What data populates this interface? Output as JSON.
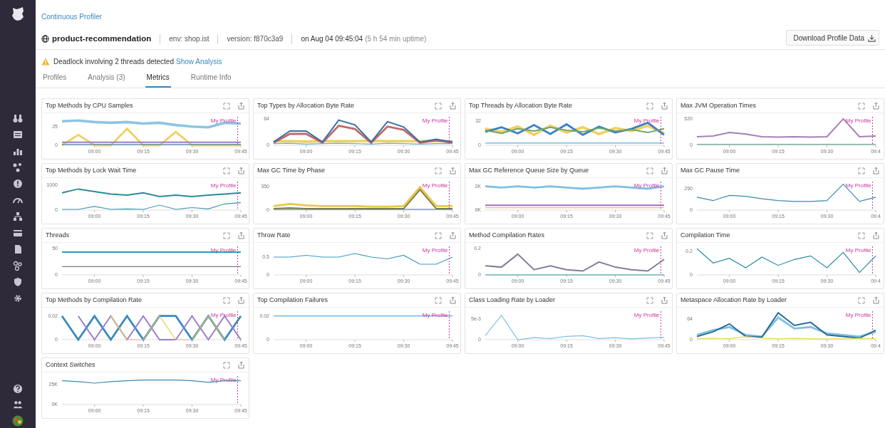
{
  "breadcrumb": "Continuous Profiler",
  "service": {
    "name": "product-recommendation",
    "env": "env: shop.ist",
    "version": "version: f870c3a9",
    "timestamp": "on Aug 04 09:45:04",
    "uptime": "(5 h 54 min uptime)"
  },
  "download_button": "Download Profile Data",
  "alert": {
    "message": "Deadlock involving 2 threads detected",
    "link": "Show Analysis"
  },
  "tabs": [
    {
      "label": "Profiles",
      "selected": false
    },
    {
      "label": "Analysis (3)",
      "selected": false
    },
    {
      "label": "Metrics",
      "selected": true
    },
    {
      "label": "Runtime Info",
      "selected": false
    }
  ],
  "panels": [
    {
      "title": "Top Methods by CPU Samples",
      "chart_data": {
        "type": "line",
        "categories": [
          null,
          null,
          "09:00",
          null,
          null,
          "09:15",
          null,
          null,
          "09:30",
          null,
          null,
          "09:45"
        ],
        "ylim": [
          0,
          38
        ],
        "yticks": [
          0,
          25
        ],
        "annotations": [
          "My Profile"
        ],
        "series": [
          {
            "color": "#8ec5e0",
            "values": [
              32,
              33,
              31,
              30,
              31,
              29,
              30,
              27,
              25,
              24,
              30,
              29
            ]
          },
          {
            "color": "#f0d060",
            "values": [
              0,
              14,
              0,
              0,
              22,
              0,
              0,
              18,
              0,
              0,
              0,
              0
            ]
          },
          {
            "color": "#9b7ec8",
            "values": [
              4,
              4,
              4,
              4,
              4,
              4,
              4,
              4,
              4,
              4,
              4,
              4
            ]
          },
          {
            "color": "#4a7fa8",
            "values": [
              1,
              1,
              1,
              1,
              1,
              1,
              1,
              1,
              1,
              1,
              1,
              1
            ]
          }
        ]
      }
    },
    {
      "title": "Top Types by Allocation Byte Rate",
      "chart_data": {
        "type": "line",
        "categories": [
          null,
          null,
          "09:00",
          null,
          null,
          "09:15",
          null,
          null,
          "09:30",
          null,
          null,
          "09:45"
        ],
        "ylim": [
          0,
          70
        ],
        "yticks": [
          0,
          64
        ],
        "annotations": [
          "My Profile"
        ],
        "series": [
          {
            "color": "#f0d060",
            "values": [
              10,
              10,
              9,
              10,
              10,
              10,
              11,
              10,
              10,
              10,
              10,
              10
            ]
          },
          {
            "color": "#c06a6a",
            "values": [
              6,
              28,
              28,
              6,
              48,
              40,
              6,
              46,
              38,
              6,
              12,
              6
            ]
          },
          {
            "color": "#3a6ea5",
            "values": [
              8,
              35,
              35,
              8,
              62,
              50,
              8,
              58,
              45,
              8,
              15,
              8
            ]
          },
          {
            "color": "#5ab0d8",
            "values": [
              4,
              5,
              3,
              4,
              5,
              4,
              3,
              5,
              4,
              3,
              4,
              4
            ]
          }
        ]
      }
    },
    {
      "title": "Top Threads by Allocation Byte Rate",
      "chart_data": {
        "type": "line",
        "categories": [
          null,
          null,
          "09:00",
          null,
          null,
          "09:15",
          null,
          null,
          "09:30",
          null,
          null,
          "09:45"
        ],
        "ylim": [
          0,
          38
        ],
        "yticks": [
          0,
          32
        ],
        "annotations": [
          "My Profile"
        ],
        "series": [
          {
            "color": "#f0d060",
            "values": [
              22,
              18,
              25,
              14,
              26,
              17,
              24,
              15,
              23,
              19,
              26,
              16
            ]
          },
          {
            "color": "#3a7fc8",
            "values": [
              18,
              24,
              16,
              27,
              15,
              28,
              14,
              25,
              17,
              22,
              30,
              14
            ]
          },
          {
            "color": "#6aa86a",
            "values": [
              20,
              16,
              22,
              19,
              24,
              20,
              18,
              23,
              19,
              21,
              17,
              22
            ]
          },
          {
            "color": "#5ab0d8",
            "values": [
              3,
              3,
              3,
              3,
              3,
              3,
              3,
              3,
              3,
              3,
              3,
              3
            ]
          }
        ]
      }
    },
    {
      "title": "Max JVM Operation Times",
      "chart_data": {
        "type": "line",
        "categories": [
          null,
          null,
          "09:00",
          null,
          null,
          "09:15",
          null,
          null,
          "09:30",
          null,
          null,
          "09:4"
        ],
        "ylim": [
          0,
          560
        ],
        "yticks": [
          0,
          520
        ],
        "annotations": [
          "My Profile"
        ],
        "series": [
          {
            "color": "#a47fb8",
            "values": [
              170,
              180,
              250,
              220,
              170,
              160,
              170,
              160,
              170,
              520,
              170,
              180
            ]
          },
          {
            "color": "#6aa88a",
            "values": [
              20,
              20,
              20,
              20,
              20,
              20,
              20,
              20,
              20,
              20,
              20,
              20
            ]
          }
        ]
      }
    },
    {
      "title": "Top Methods by Lock Wait Time",
      "chart_data": {
        "type": "line",
        "categories": [
          null,
          null,
          "09:00",
          null,
          null,
          "09:15",
          null,
          null,
          "09:30",
          null,
          null,
          "09:45"
        ],
        "ylim": [
          0,
          1150
        ],
        "yticks": [
          0,
          1000
        ],
        "annotations": [
          "My Profile"
        ],
        "series": [
          {
            "color": "#2a8a9a",
            "values": [
              700,
              850,
              750,
              650,
              600,
              700,
              550,
              600,
              550,
              600,
              650,
              700
            ]
          },
          {
            "color": "#3a9aa8",
            "values": [
              30,
              30,
              150,
              30,
              50,
              30,
              200,
              30,
              100,
              50,
              250,
              300
            ]
          }
        ]
      }
    },
    {
      "title": "Max GC Time by Phase",
      "chart_data": {
        "type": "line",
        "categories": [
          null,
          null,
          "09:00",
          null,
          null,
          "09:15",
          null,
          null,
          "09:30",
          null,
          null,
          "09:45"
        ],
        "ylim": [
          0,
          420
        ],
        "yticks": [
          0,
          350
        ],
        "annotations": [
          "My Profile"
        ],
        "series": [
          {
            "color": "#e8c84a",
            "values": [
              60,
              90,
              70,
              60,
              60,
              60,
              50,
              50,
              60,
              340,
              60,
              60
            ]
          },
          {
            "color": "#8a7a40",
            "values": [
              20,
              30,
              20,
              20,
              20,
              20,
              20,
              20,
              20,
              300,
              20,
              20
            ]
          },
          {
            "color": "#4a6ab8",
            "values": [
              10,
              10,
              10,
              10,
              10,
              10,
              10,
              10,
              10,
              10,
              10,
              10
            ]
          }
        ]
      }
    },
    {
      "title": "Max GC Reference Queue Size by Queue",
      "chart_data": {
        "type": "line",
        "categories": [
          null,
          null,
          "09:00",
          null,
          null,
          "09:15",
          null,
          null,
          "09:30",
          null,
          null,
          "09:45"
        ],
        "ylim": [
          0,
          2400
        ],
        "yticks": [
          {
            "value": 0,
            "label": "0K"
          },
          {
            "value": 2000,
            "label": "2K"
          }
        ],
        "annotations": [
          "My Profile"
        ],
        "series": [
          {
            "color": "#7ec0e0",
            "values": [
              2000,
              1900,
              2000,
              1900,
              2000,
              1900,
              1800,
              1900,
              2000,
              1900,
              1800,
              2000
            ]
          },
          {
            "color": "#9b6ec8",
            "values": [
              400,
              400,
              400,
              400,
              400,
              400,
              400,
              400,
              400,
              400,
              400,
              400
            ]
          },
          {
            "color": "#e8c84a",
            "values": [
              200,
              200,
              200,
              200,
              200,
              200,
              200,
              200,
              200,
              200,
              200,
              200
            ]
          }
        ]
      }
    },
    {
      "title": "Max GC Pause Time",
      "chart_data": {
        "type": "line",
        "categories": [
          null,
          null,
          "09:00",
          null,
          null,
          "09:15",
          null,
          null,
          "09:30",
          null,
          null,
          "09:4"
        ],
        "ylim": [
          0,
          330
        ],
        "yticks": [
          0,
          250
        ],
        "annotations": [
          "My Profile"
        ],
        "series": [
          {
            "color": "#3a8ab0",
            "values": [
              150,
              110,
              170,
              160,
              130,
              110,
              100,
              100,
              110,
              300,
              100,
              150
            ]
          }
        ]
      }
    },
    {
      "title": "Threads",
      "chart_data": {
        "type": "line",
        "categories": [
          null,
          null,
          "09:00",
          null,
          null,
          "09:15",
          null,
          null,
          "09:30",
          null,
          null,
          "09:45"
        ],
        "ylim": [
          0,
          55
        ],
        "yticks": [
          0,
          50
        ],
        "annotations": [
          "My Profile"
        ],
        "series": [
          {
            "color": "#2a9ac0",
            "values": [
              44,
              44,
              44,
              44,
              44,
              44,
              44,
              44,
              44,
              44,
              44,
              44
            ]
          },
          {
            "color": "#7a7a8a",
            "values": [
              16,
              16,
              16,
              16,
              16,
              16,
              16,
              16,
              16,
              16,
              16,
              16
            ]
          }
        ]
      }
    },
    {
      "title": "Throw Rate",
      "chart_data": {
        "type": "line",
        "categories": [
          null,
          null,
          "09:00",
          null,
          null,
          "09:15",
          null,
          null,
          "09:30",
          null,
          null,
          "09:45"
        ],
        "ylim": [
          0,
          0.8
        ],
        "yticks": [
          0,
          0.5
        ],
        "annotations": [
          "My Profile"
        ],
        "series": [
          {
            "color": "#3a9ac0",
            "values": [
              0.5,
              0.5,
              0.55,
              0.5,
              0.5,
              0.6,
              0.5,
              0.45,
              0.55,
              0.3,
              0.3,
              0.5
            ]
          }
        ]
      }
    },
    {
      "title": "Method Compilation Rates",
      "chart_data": {
        "type": "line",
        "categories": [
          null,
          null,
          "09:00",
          null,
          null,
          "09:15",
          null,
          null,
          "09:30",
          null,
          null,
          "09:45"
        ],
        "ylim": [
          0,
          0.22
        ],
        "yticks": [
          0,
          0.2
        ],
        "annotations": [
          "My Profile"
        ],
        "series": [
          {
            "color": "#8a7a9a",
            "values": [
              0.07,
              0.06,
              0.16,
              0.04,
              0.07,
              0.04,
              0.03,
              0.1,
              0.06,
              0.04,
              0.03,
              0.12
            ]
          },
          {
            "color": "#2a9ab0",
            "values": [
              0,
              0,
              0,
              0,
              0,
              0,
              0,
              0,
              0,
              0,
              0,
              0
            ]
          }
        ]
      }
    },
    {
      "title": "Compilation Time",
      "chart_data": {
        "type": "line",
        "categories": [
          null,
          null,
          "09:00",
          null,
          null,
          "09:15",
          null,
          null,
          "09:30",
          null,
          null,
          "09:4"
        ],
        "ylim": [
          0,
          0.24
        ],
        "yticks": [
          0,
          0.2
        ],
        "annotations": [
          "My Profile"
        ],
        "series": [
          {
            "color": "#2a8aa0",
            "values": [
              0.22,
              0.1,
              0.14,
              0.06,
              0.15,
              0.08,
              0.13,
              0.16,
              0.06,
              0.19,
              0.02,
              0.16
            ]
          }
        ]
      }
    },
    {
      "title": "Top Methods by Compilation Rate",
      "chart_data": {
        "type": "line",
        "categories": [
          null,
          null,
          "09:00",
          null,
          null,
          "09:15",
          null,
          null,
          "09:30",
          null,
          null,
          "09:45"
        ],
        "ylim": [
          0,
          0.024
        ],
        "yticks": [
          0,
          0.02
        ],
        "annotations": [
          "My Profile"
        ],
        "series": [
          {
            "color": "#3a8ac0",
            "values": [
              0.02,
              0,
              0.02,
              0,
              0.02,
              0,
              0.02,
              0.02,
              0,
              0.02,
              0,
              0.02
            ]
          },
          {
            "color": "#9b7ec8",
            "values": [
              null,
              0.02,
              0,
              0.02,
              0,
              0.02,
              0,
              0,
              0.02,
              0,
              0.02,
              0
            ]
          },
          {
            "color": "#e8c84a",
            "values": [
              null,
              null,
              null,
              0.02,
              0,
              0,
              0.02,
              0,
              0,
              0.02,
              0,
              null
            ]
          }
        ]
      }
    },
    {
      "title": "Top Compilation Failures",
      "chart_data": {
        "type": "line",
        "categories": [
          null,
          null,
          "09:00",
          null,
          null,
          "09:15",
          null,
          null,
          "09:30",
          null,
          null,
          "09:45"
        ],
        "ylim": [
          0,
          0.024
        ],
        "yticks": [
          0,
          0.02
        ],
        "annotations": [
          "My Profile"
        ],
        "series": [
          {
            "color": "#5ab0d8",
            "values": [
              0.02,
              0.02,
              0.02,
              0.02,
              0.02,
              0.02,
              0.02,
              0.02,
              0.02,
              0.02,
              0.02,
              0.02
            ]
          }
        ]
      }
    },
    {
      "title": "Class Loading Rate by Loader",
      "chart_data": {
        "type": "line",
        "categories": [
          null,
          null,
          "09:00",
          null,
          null,
          "09:15",
          null,
          null,
          "09:30",
          null,
          null,
          "09:45"
        ],
        "ylim": [
          0,
          0.007
        ],
        "yticks": [
          0,
          {
            "value": 0.005,
            "label": "5e-3"
          }
        ],
        "annotations": [
          "My Profile"
        ],
        "series": [
          {
            "color": "#7ec0e0",
            "values": [
              0.001,
              0.006,
              0,
              0.0005,
              0.0003,
              0.0008,
              0.001,
              0.0003,
              0.0005,
              0.0002,
              0.0004,
              0.0006
            ]
          }
        ]
      }
    },
    {
      "title": "Metaspace Allocation Rate by Loader",
      "chart_data": {
        "type": "line",
        "categories": [
          null,
          null,
          "09:00",
          null,
          null,
          "09:15",
          null,
          null,
          "09:30",
          null,
          null,
          "09:4"
        ],
        "ylim": [
          0,
          90
        ],
        "yticks": [
          0,
          64
        ],
        "annotations": [
          "My Profile"
        ],
        "series": [
          {
            "color": "#7ec0e0",
            "values": [
              15,
              30,
              40,
              15,
              10,
              70,
              35,
              40,
              20,
              15,
              10,
              25
            ]
          },
          {
            "color": "#2a6a98",
            "values": [
              10,
              25,
              50,
              10,
              8,
              85,
              45,
              55,
              15,
              10,
              5,
              30
            ]
          },
          {
            "color": "#e8d84a",
            "values": [
              3,
              5,
              3,
              10,
              5,
              3,
              4,
              3,
              2,
              3,
              4,
              3
            ]
          }
        ]
      }
    },
    {
      "title": "Context Switches",
      "chart_data": {
        "type": "line",
        "categories": [
          null,
          null,
          "09:00",
          null,
          null,
          "09:15",
          null,
          null,
          "09:30",
          null,
          null,
          "09:45"
        ],
        "ylim": [
          0,
          36000
        ],
        "yticks": [
          {
            "value": 0,
            "label": "0K"
          },
          {
            "value": 25000,
            "label": "25K"
          }
        ],
        "annotations": [
          "My Profile"
        ],
        "series": [
          {
            "color": "#3a8ab0",
            "values": [
              30000,
              29000,
              27000,
              29000,
              30000,
              31000,
              31000,
              31000,
              30000,
              28000,
              30000,
              30000
            ]
          }
        ]
      }
    }
  ]
}
